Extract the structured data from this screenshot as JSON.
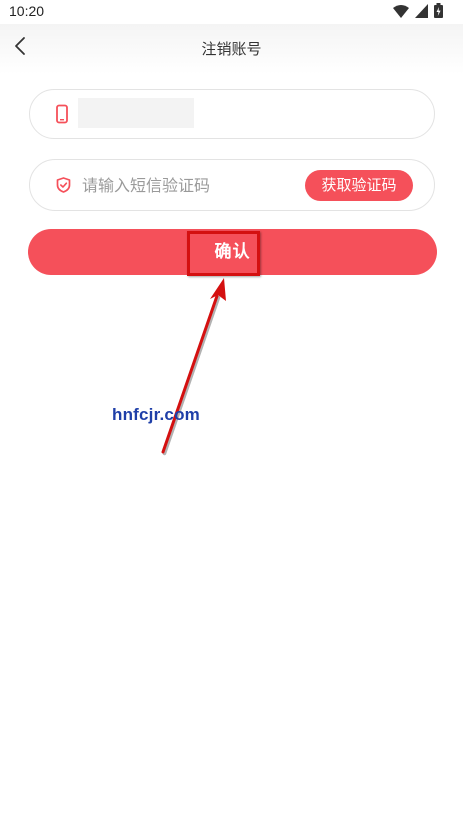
{
  "status_bar": {
    "time": "10:20",
    "icons": [
      "wifi-icon",
      "signal-icon",
      "battery-icon"
    ]
  },
  "header": {
    "back_icon": "chevron-left-icon",
    "title": "注销账号"
  },
  "form": {
    "phone": {
      "icon": "phone-icon",
      "value": ""
    },
    "code": {
      "icon": "shield-icon",
      "placeholder": "请输入短信验证码",
      "value": "",
      "button_label": "获取验证码"
    },
    "confirm_label": "确认"
  },
  "annotation": {
    "watermark": "hnfcjr.com"
  },
  "colors": {
    "accent": "#f5505a",
    "annotation_red": "#d41010",
    "watermark_blue": "#1f3fa8"
  }
}
